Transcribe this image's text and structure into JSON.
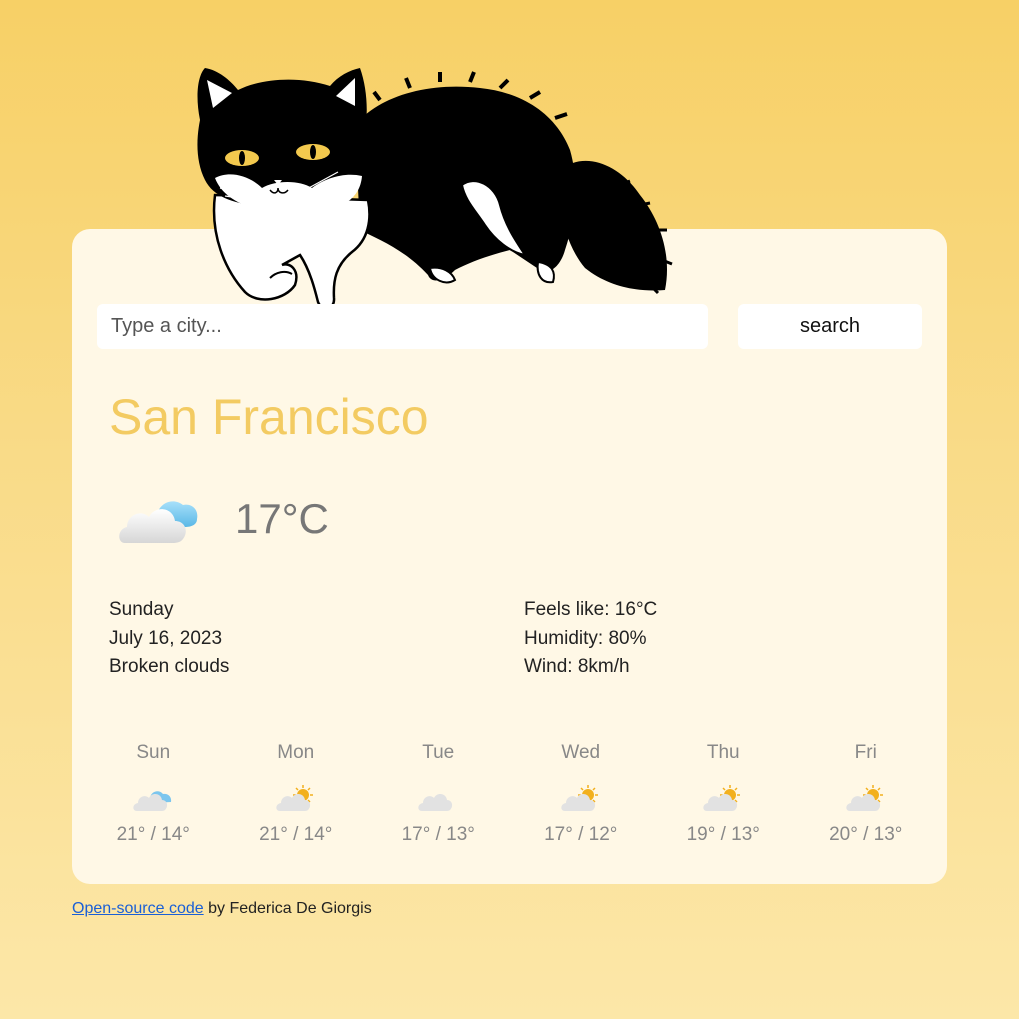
{
  "search": {
    "placeholder": "Type a city...",
    "button_label": "search"
  },
  "current": {
    "city": "San Francisco",
    "icon": "broken-clouds-icon",
    "temperature": "17°C",
    "day": "Sunday",
    "date": "July 16, 2023",
    "description": "Broken clouds",
    "feels_like": "Feels like: 16°C",
    "humidity": "Humidity: 80%",
    "wind": "Wind: 8km/h"
  },
  "forecast": [
    {
      "day": "Sun",
      "icon": "broken-clouds-icon",
      "temps": "21° / 14°"
    },
    {
      "day": "Mon",
      "icon": "partly-cloudy-icon",
      "temps": "21° / 14°"
    },
    {
      "day": "Tue",
      "icon": "cloudy-icon",
      "temps": "17° / 13°"
    },
    {
      "day": "Wed",
      "icon": "partly-cloudy-icon",
      "temps": "17° / 12°"
    },
    {
      "day": "Thu",
      "icon": "partly-cloudy-icon",
      "temps": "19° / 13°"
    },
    {
      "day": "Fri",
      "icon": "partly-cloudy-icon",
      "temps": "20° / 13°"
    }
  ],
  "footer": {
    "link_text": "Open-source code",
    "suffix": "by Federica De Giorgis"
  },
  "colors": {
    "background": "#f7d066",
    "card": "#fff8e6",
    "city": "#f3cb62",
    "link": "#1a5fd6",
    "sun": "#f2b01e",
    "cloud_accent": "#8fd0f0"
  }
}
